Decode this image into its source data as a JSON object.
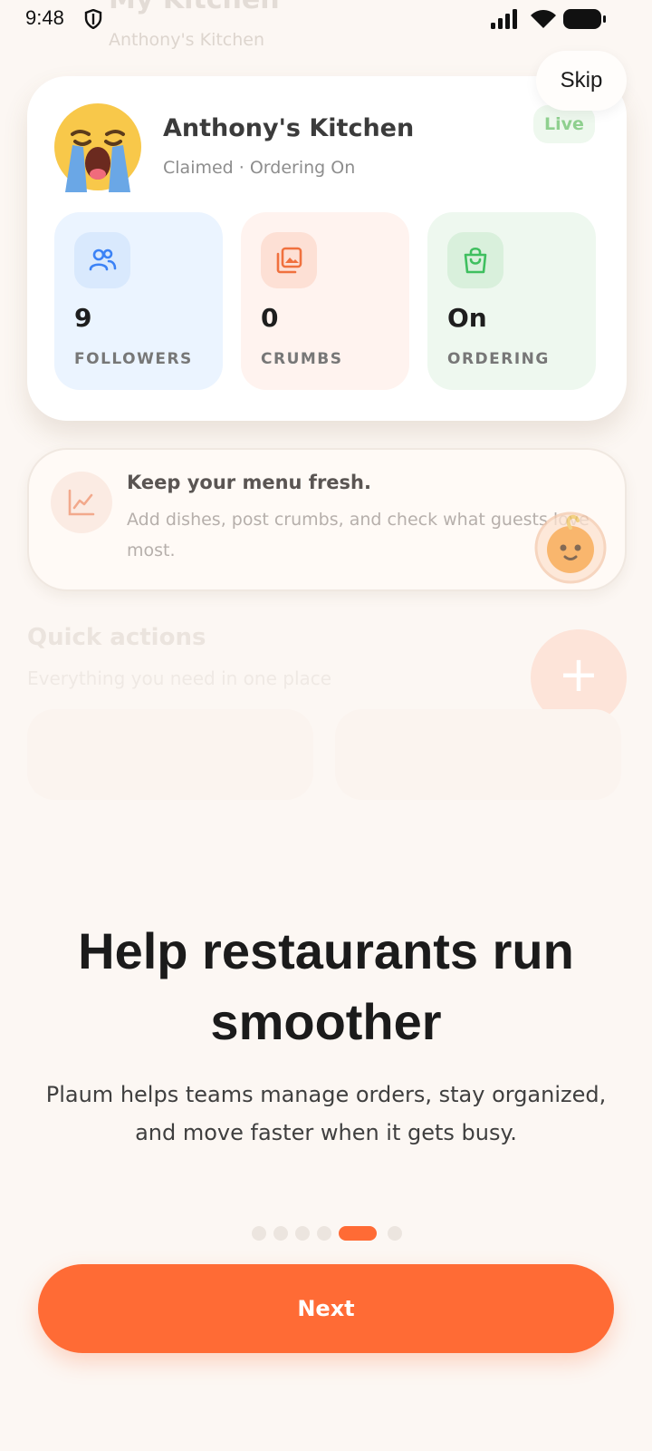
{
  "status_bar": {
    "time": "9:48"
  },
  "background": {
    "header_title": "My Kitchen",
    "header_subtitle": "Anthony's Kitchen",
    "quick_actions_title": "Quick actions",
    "quick_actions_subtitle": "Everything you need in one place",
    "fab_label": "+"
  },
  "skip_label": "Skip",
  "kitchen_card": {
    "avatar_icon": "crying-face-emoji",
    "name": "Anthony's Kitchen",
    "status": "Claimed · Ordering On",
    "badge": "Live",
    "stats": [
      {
        "value": "9",
        "label": "FOLLOWERS",
        "icon": "people-icon",
        "color": "#3b82f6"
      },
      {
        "value": "0",
        "label": "CRUMBS",
        "icon": "photos-icon",
        "color": "#f0713e"
      },
      {
        "value": "On",
        "label": "ORDERING",
        "icon": "shopping-bag-icon",
        "color": "#3fbf5f"
      }
    ]
  },
  "tip_card": {
    "icon": "trend-chart-icon",
    "title": "Keep your menu fresh.",
    "body": "Add dishes, post crumbs, and check what guests love most."
  },
  "onboarding": {
    "title": "Help restaurants run smoother",
    "body": "Plaum helps teams manage orders, stay organized, and move faster when it gets busy.",
    "total_pages": 6,
    "current_page": 5
  },
  "next_label": "Next",
  "colors": {
    "accent": "#ff6b35",
    "background": "#fcf7f3"
  }
}
